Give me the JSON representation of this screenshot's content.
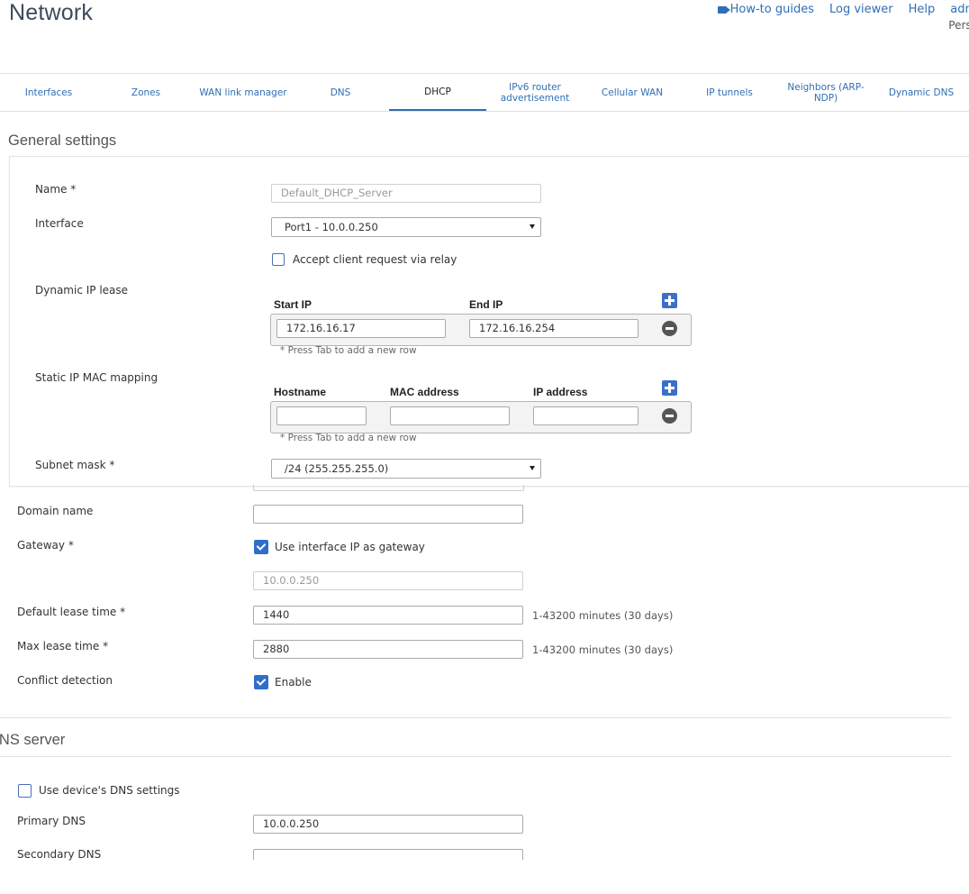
{
  "header": {
    "title": "Network",
    "links": [
      "How-to guides",
      "Log viewer",
      "Help",
      "admin"
    ],
    "subuser": "Perso"
  },
  "tabs": [
    {
      "label": "Interfaces",
      "active": false
    },
    {
      "label": "Zones",
      "active": false
    },
    {
      "label": "WAN link manager",
      "active": false
    },
    {
      "label": "DNS",
      "active": false
    },
    {
      "label": "DHCP",
      "active": true
    },
    {
      "label": "IPv6 router advertisement",
      "active": false
    },
    {
      "label": "Cellular WAN",
      "active": false
    },
    {
      "label": "IP tunnels",
      "active": false
    },
    {
      "label": "Neighbors (ARP-NDP)",
      "active": false
    },
    {
      "label": "Dynamic DNS",
      "active": false
    }
  ],
  "general": {
    "section_title": "General settings",
    "name_label": "Name *",
    "name_placeholder": "Default_DHCP_Server",
    "interface_label": "Interface",
    "interface_value": "Port1 - 10.0.0.250",
    "relay_label": "Accept client request via relay",
    "dynamic_label": "Dynamic IP lease",
    "start_ip_header": "Start IP",
    "end_ip_header": "End IP",
    "start_ip": "172.16.16.17",
    "end_ip": "172.16.16.254",
    "tab_hint": "* Press Tab to add a new row",
    "static_label": "Static IP MAC mapping",
    "hostname_header": "Hostname",
    "mac_header": "MAC address",
    "ip_header": "IP address",
    "static_hint": "* Press Tab to add a new row",
    "subnet_label": "Subnet mask *",
    "subnet_value": "/24 (255.255.255.0)",
    "domain_label": "Domain name",
    "domain_value": "",
    "gateway_label": "Gateway *",
    "gateway_check_label": "Use interface IP as gateway",
    "gateway_value": "10.0.0.250",
    "default_lease_label": "Default lease time *",
    "default_lease_value": "1440",
    "default_lease_hint": "1-43200 minutes (30 days)",
    "max_lease_label": "Max lease time *",
    "max_lease_value": "2880",
    "max_lease_hint": "1-43200 minutes (30 days)",
    "conflict_label": "Conflict detection",
    "conflict_check_label": "Enable"
  },
  "dns": {
    "section_title": "DNS server",
    "use_device_label": "Use device's DNS settings",
    "primary_label": "Primary DNS",
    "primary_value": "10.0.0.250",
    "secondary_label": "Secondary DNS",
    "secondary_value": ""
  }
}
